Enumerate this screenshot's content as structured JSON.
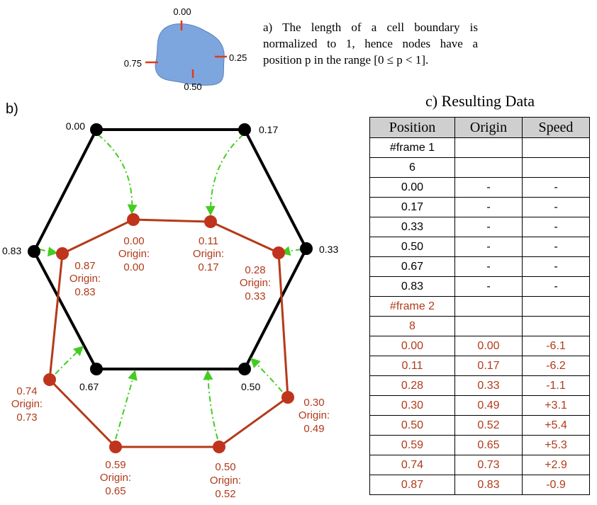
{
  "panel_a": {
    "text_lines": [
      "a) The length of a cell boundary is",
      "normalized to 1, hence nodes have a",
      "position p in the range [0 ≤ p < 1]."
    ],
    "cell_labels": [
      "0.00",
      "0.25",
      "0.50",
      "0.75"
    ],
    "colors": {
      "cell_fill": "#7ea6de",
      "tick": "#e03a1a"
    }
  },
  "panel_b": {
    "label": "b)",
    "frame1_nodes": [
      {
        "label": "0.00"
      },
      {
        "label": "0.17"
      },
      {
        "label": "0.33"
      },
      {
        "label": "0.50"
      },
      {
        "label": "0.67"
      },
      {
        "label": "0.83"
      }
    ],
    "frame2_nodes": [
      {
        "position": "0.00",
        "origin_label": "Origin:",
        "origin": "0.00"
      },
      {
        "position": "0.11",
        "origin_label": "Origin:",
        "origin": "0.17"
      },
      {
        "position": "0.28",
        "origin_label": "Origin:",
        "origin": "0.33"
      },
      {
        "position": "0.30",
        "origin_label": "Origin:",
        "origin": "0.49"
      },
      {
        "position": "0.50",
        "origin_label": "Origin:",
        "origin": "0.52"
      },
      {
        "position": "0.59",
        "origin_label": "Origin:",
        "origin": "0.65"
      },
      {
        "position": "0.74",
        "origin_label": "Origin:",
        "origin": "0.73"
      },
      {
        "position": "0.87",
        "origin_label": "Origin:",
        "origin": "0.83"
      }
    ],
    "colors": {
      "frame1": "#000000",
      "frame2_line": "#b43a1a",
      "frame2_node": "#c0331c",
      "arrow": "#44cc22"
    }
  },
  "panel_c": {
    "title": "c) Resulting Data",
    "headers": [
      "Position",
      "Origin",
      "Speed"
    ],
    "rows": [
      {
        "cells": [
          "#frame 1",
          "",
          ""
        ],
        "frame": 1
      },
      {
        "cells": [
          "6",
          "",
          ""
        ],
        "frame": 1
      },
      {
        "cells": [
          "0.00",
          "-",
          "-"
        ],
        "frame": 1
      },
      {
        "cells": [
          "0.17",
          "-",
          "-"
        ],
        "frame": 1
      },
      {
        "cells": [
          "0.33",
          "-",
          "-"
        ],
        "frame": 1
      },
      {
        "cells": [
          "0.50",
          "-",
          "-"
        ],
        "frame": 1
      },
      {
        "cells": [
          "0.67",
          "-",
          "-"
        ],
        "frame": 1
      },
      {
        "cells": [
          "0.83",
          "-",
          "-"
        ],
        "frame": 1
      },
      {
        "cells": [
          "#frame 2",
          "",
          ""
        ],
        "frame": 2
      },
      {
        "cells": [
          "8",
          "",
          ""
        ],
        "frame": 2
      },
      {
        "cells": [
          "0.00",
          "0.00",
          "-6.1"
        ],
        "frame": 2
      },
      {
        "cells": [
          "0.11",
          "0.17",
          "-6.2"
        ],
        "frame": 2
      },
      {
        "cells": [
          "0.28",
          "0.33",
          "-1.1"
        ],
        "frame": 2
      },
      {
        "cells": [
          "0.30",
          "0.49",
          "+3.1"
        ],
        "frame": 2
      },
      {
        "cells": [
          "0.50",
          "0.52",
          "+5.4"
        ],
        "frame": 2
      },
      {
        "cells": [
          "0.59",
          "0.65",
          "+5.3"
        ],
        "frame": 2
      },
      {
        "cells": [
          "0.74",
          "0.73",
          "+2.9"
        ],
        "frame": 2
      },
      {
        "cells": [
          "0.87",
          "0.83",
          "-0.9"
        ],
        "frame": 2
      }
    ]
  }
}
